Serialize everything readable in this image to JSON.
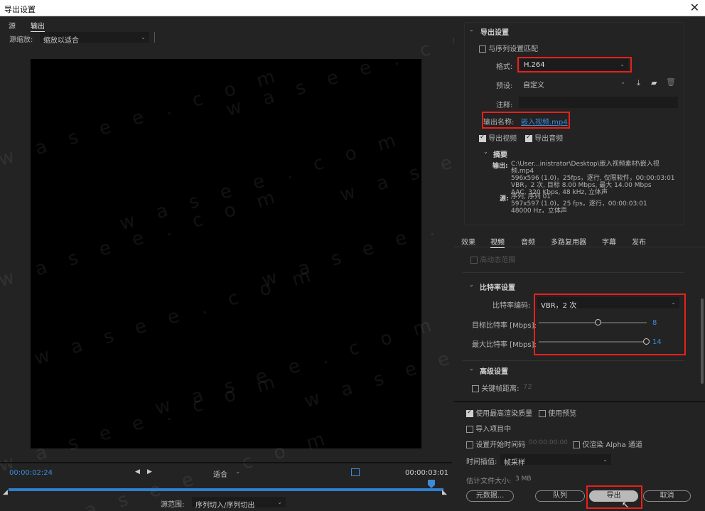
{
  "window": {
    "title": "导出设置",
    "close": "✕"
  },
  "left": {
    "tabs": [
      "源",
      "输出"
    ],
    "zoom_label": "源缩放:",
    "zoom_value": "缩放以适合",
    "time_current": "00:00:02:24",
    "time_end": "00:00:03:01",
    "fit_value": "适合",
    "range_label": "源范围:",
    "range_value": "序列切入/序列切出"
  },
  "export": {
    "section_title": "导出设置",
    "match_sequence": "与序列设置匹配",
    "format_label": "格式:",
    "format_value": "H.264",
    "preset_label": "预设:",
    "preset_value": "自定义",
    "comment_label": "注释:",
    "output_name_label": "输出名称:",
    "output_name_value": "嵌入视频.mp4",
    "export_video": "导出视频",
    "export_audio": "导出音频",
    "summary_title": "摘要",
    "output_label": "输出:",
    "output_lines": [
      "C:\\User...inistrator\\Desktop\\嵌入视频素材\\嵌入视频.mp4",
      "596x596 (1.0)，25fps，逐行, 仅限软件，00:00:03:01",
      "VBR，2 次, 目标 8.00 Mbps, 最大 14.00 Mbps",
      "AAC, 320 Kbps, 48  kHz, 立体声"
    ],
    "source_label": "源:",
    "source_lines": [
      "序列, 序列 01",
      "597x597  (1.0)，25 fps，逐行，00:00:03:01",
      "48000  Hz，立体声"
    ]
  },
  "tabs2": [
    "效果",
    "视频",
    "音频",
    "多路复用器",
    "字幕",
    "发布"
  ],
  "video": {
    "hdr_range": "高动态范围",
    "bitrate_section": "比特率设置",
    "encoding_label": "比特率编码:",
    "encoding_value": "VBR，2 次",
    "target_label": "目标比特率 [Mbps]:",
    "target_value": "8",
    "target_level": 0.55,
    "max_label": "最大比特率 [Mbps]:",
    "max_value": "14",
    "max_level": 1.0,
    "advanced_section": "高级设置",
    "keyframe_label": "关键帧距离:",
    "keyframe_value": "72"
  },
  "bottom": {
    "max_render": "使用最高渲染质量",
    "use_preview": "使用预览",
    "import_project": "导入项目中",
    "set_start_tc": "设置开始时间码",
    "start_tc_value": "00:00:00:00",
    "alpha_only": "仅渲染 Alpha 通道",
    "interp_label": "时间插值:",
    "interp_value": "帧采样",
    "filesize_label": "估计文件大小:",
    "filesize_value": "3 MB",
    "metadata_btn": "元数据...",
    "queue_btn": "队列",
    "export_btn": "导出",
    "cancel_btn": "取消"
  },
  "watermark": "w a s e e . c o m"
}
